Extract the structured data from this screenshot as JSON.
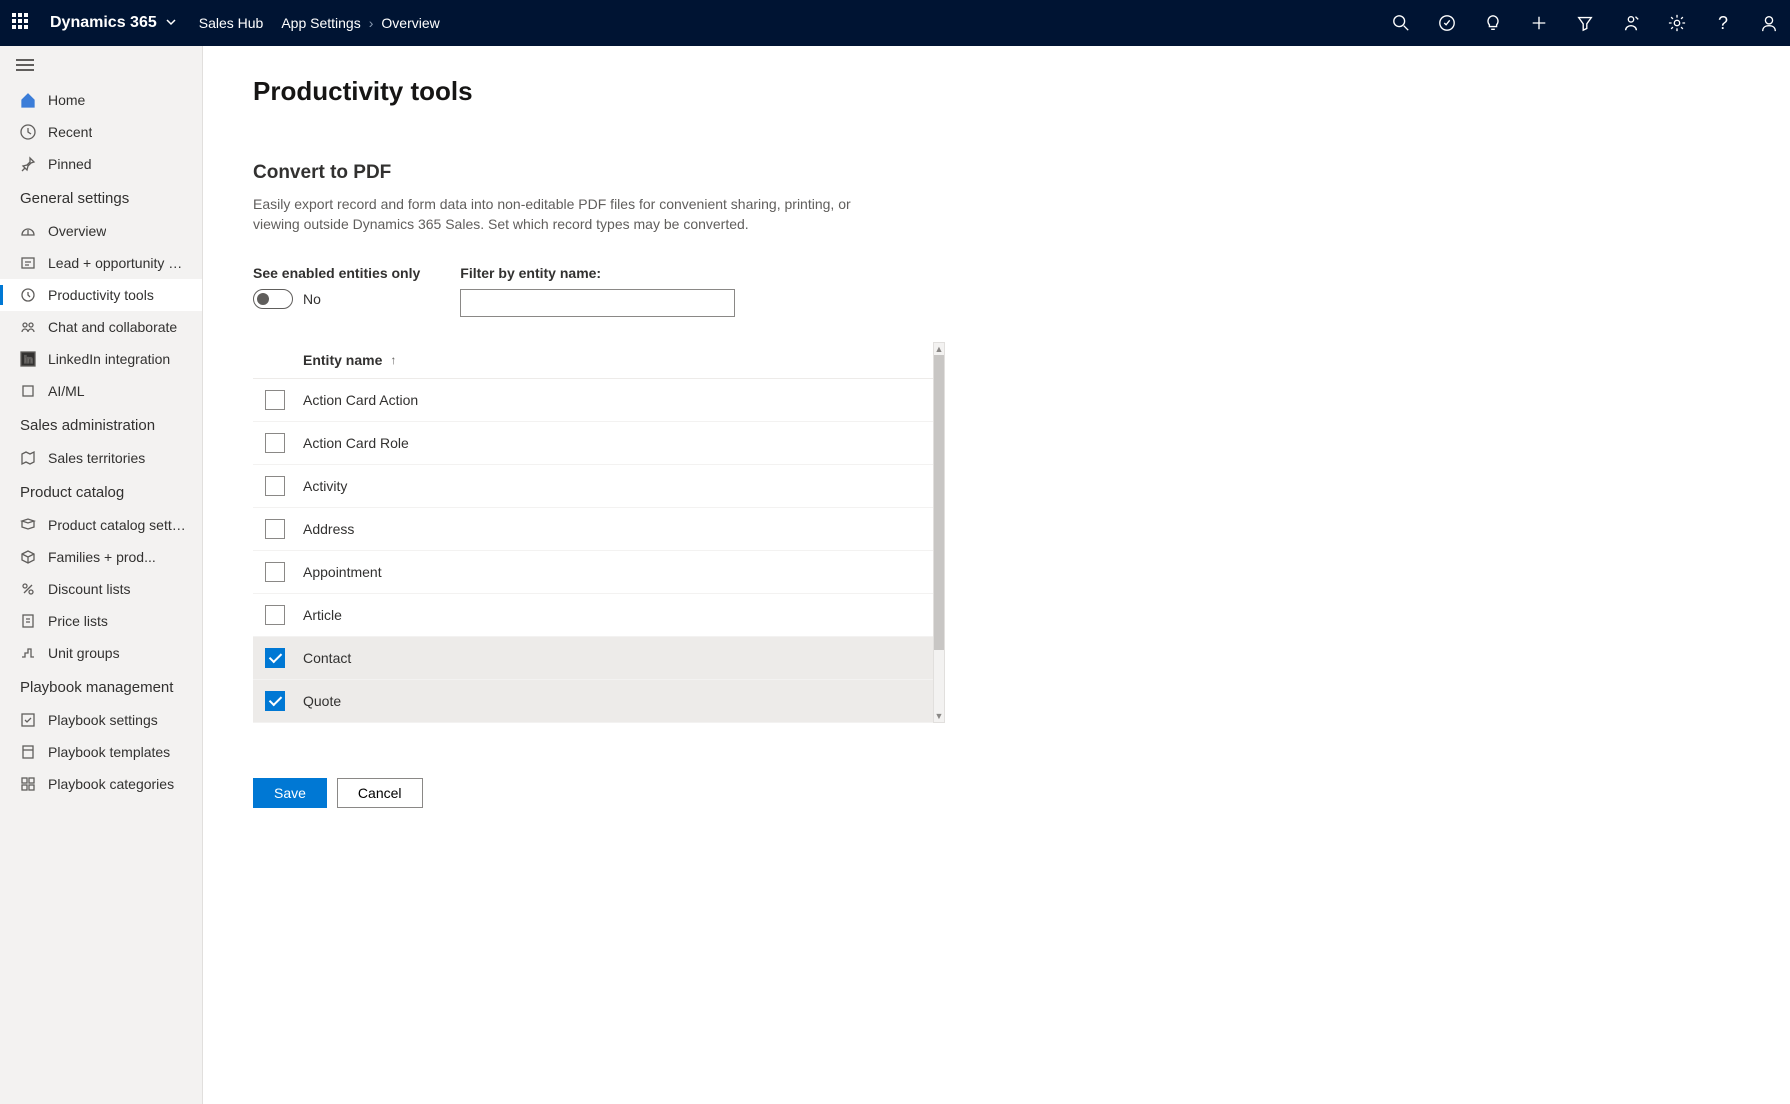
{
  "topbar": {
    "brand": "Dynamics 365",
    "app": "Sales Hub",
    "crumb1": "App Settings",
    "crumb2": "Overview"
  },
  "sidebar": {
    "home": "Home",
    "recent": "Recent",
    "pinned": "Pinned",
    "sections": {
      "general": "General settings",
      "general_items": {
        "overview": "Overview",
        "lead": "Lead + opportunity ma...",
        "productivity": "Productivity tools",
        "chat": "Chat and collaborate",
        "linkedin": "LinkedIn integration",
        "aiml": "AI/ML"
      },
      "sales_admin": "Sales administration",
      "sales_admin_items": {
        "territories": "Sales territories"
      },
      "product_catalog": "Product catalog",
      "product_items": {
        "pcs": "Product catalog settings",
        "fam": "Families + prod...",
        "disc": "Discount lists",
        "price": "Price lists",
        "unit": "Unit groups"
      },
      "playbook": "Playbook management",
      "playbook_items": {
        "pbs": "Playbook settings",
        "pbt": "Playbook templates",
        "pbc": "Playbook categories"
      }
    }
  },
  "page": {
    "title": "Productivity tools",
    "section_title": "Convert to PDF",
    "section_desc": "Easily export record and form data into non-editable PDF files for convenient sharing, printing, or viewing outside Dynamics 365 Sales. Set which record types may be converted.",
    "see_enabled_label": "See enabled entities only",
    "see_enabled_value": "No",
    "filter_label": "Filter by entity name:",
    "filter_value": "",
    "col_header": "Entity name",
    "entities": [
      {
        "name": "Action Card Action",
        "checked": false
      },
      {
        "name": "Action Card Role",
        "checked": false
      },
      {
        "name": "Activity",
        "checked": false
      },
      {
        "name": "Address",
        "checked": false
      },
      {
        "name": "Appointment",
        "checked": false
      },
      {
        "name": "Article",
        "checked": false
      },
      {
        "name": "Contact",
        "checked": true
      },
      {
        "name": "Quote",
        "checked": true
      }
    ],
    "save": "Save",
    "cancel": "Cancel"
  }
}
